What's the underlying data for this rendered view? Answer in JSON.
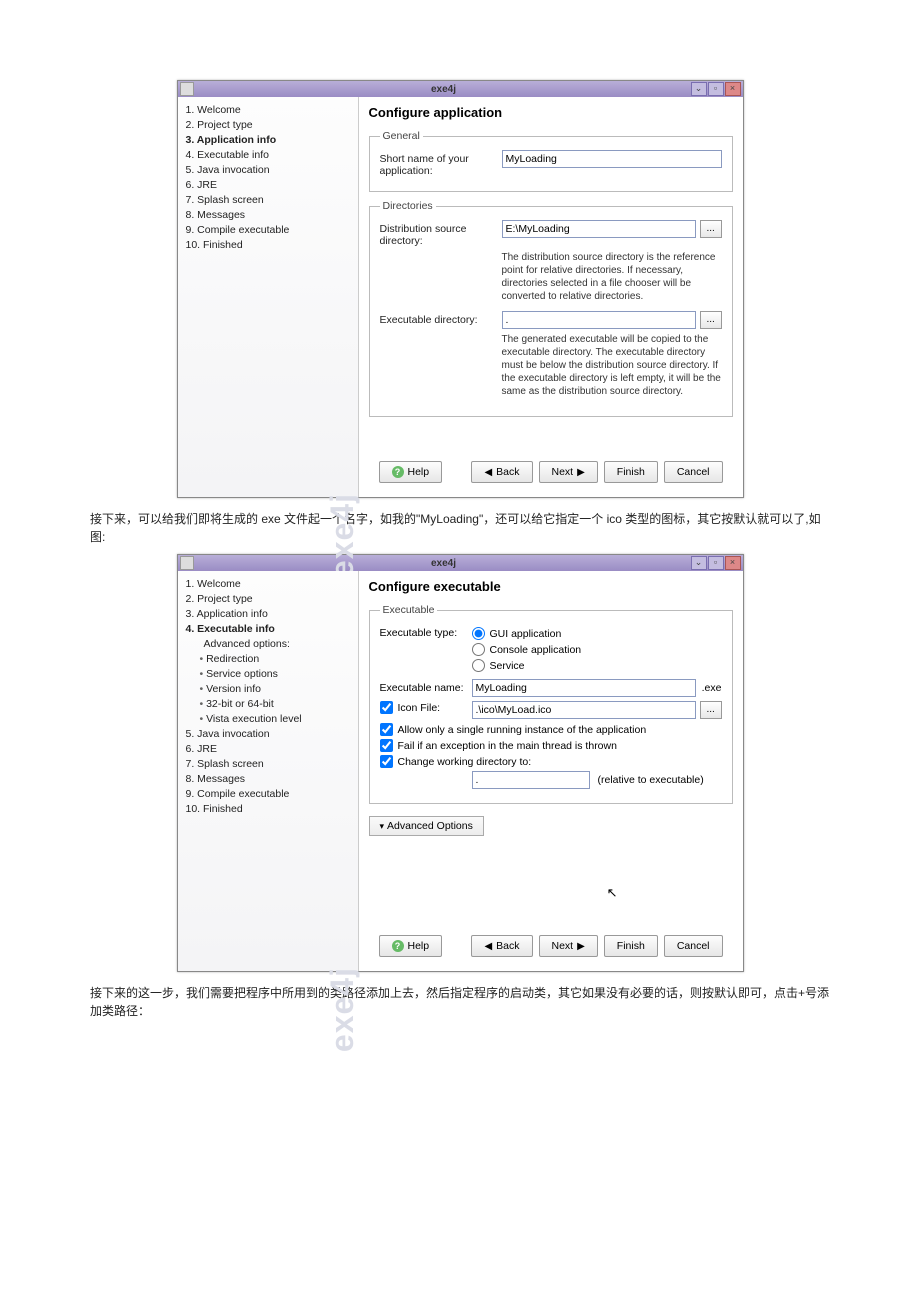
{
  "win1": {
    "title": "exe4j",
    "side": [
      "1. Welcome",
      "2. Project type",
      "3. Application info",
      "4. Executable info",
      "5. Java invocation",
      "6. JRE",
      "7. Splash screen",
      "8. Messages",
      "9. Compile executable",
      "10. Finished"
    ],
    "activeIdx": 2,
    "heading": "Configure application",
    "general": {
      "legend": "General",
      "shortNameLbl": "Short name of your application:",
      "shortName": "MyLoading"
    },
    "dirs": {
      "legend": "Directories",
      "distLbl": "Distribution source directory:",
      "dist": "E:\\MyLoading",
      "distHelp": "The distribution source directory is the reference point for relative directories. If necessary, directories selected in a file chooser will be converted to relative directories.",
      "exeLbl": "Executable directory:",
      "exe": ".",
      "exeHelp": "The generated executable will be copied to the executable directory. The executable directory must be below the distribution source directory. If the executable directory is left empty, it will be the same as the distribution source directory."
    },
    "buttons": {
      "help": "Help",
      "back": "Back",
      "next": "Next",
      "finish": "Finish",
      "cancel": "Cancel"
    }
  },
  "para1": "接下来，可以给我们即将生成的 exe 文件起一个名字，如我的\"MyLoading\"，还可以给它指定一个 ico 类型的图标，其它按默认就可以了,如图:",
  "win2": {
    "title": "exe4j",
    "side": [
      "1. Welcome",
      "2. Project type",
      "3. Application info",
      "4. Executable info",
      "Advanced options:",
      "Redirection",
      "Service options",
      "Version info",
      "32-bit or 64-bit",
      "Vista execution level",
      "5. Java invocation",
      "6. JRE",
      "7. Splash screen",
      "8. Messages",
      "9. Compile executable",
      "10. Finished"
    ],
    "heading": "Configure executable",
    "exe": {
      "legend": "Executable",
      "typeLbl": "Executable type:",
      "r1": "GUI application",
      "r2": "Console application",
      "r3": "Service",
      "nameLbl": "Executable name:",
      "name": "MyLoading",
      "nameSuffix": ".exe",
      "iconLbl": "Icon File:",
      "icon": ".\\ico\\MyLoad.ico",
      "cb1": "Allow only a single running instance of the application",
      "cb2": "Fail if an exception in the main thread is thrown",
      "cb3": "Change working directory to:",
      "wd": ".",
      "wdHint": "(relative to executable)"
    },
    "adv": "Advanced Options",
    "buttons": {
      "help": "Help",
      "back": "Back",
      "next": "Next",
      "finish": "Finish",
      "cancel": "Cancel"
    }
  },
  "para2": "接下来的这一步，我们需要把程序中所用到的类路径添加上去，然后指定程序的启动类，其它如果没有必要的话，则按默认即可，点击+号添加类路径："
}
